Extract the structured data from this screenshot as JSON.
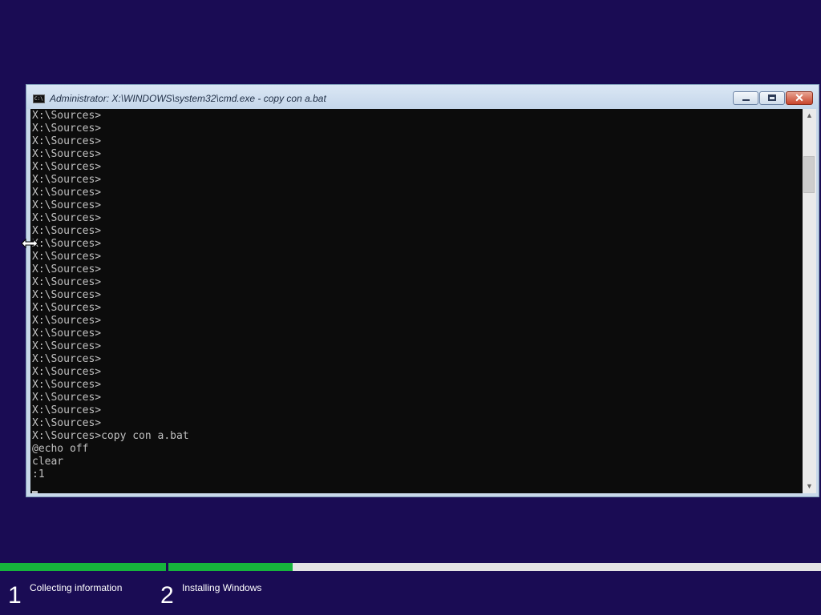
{
  "window": {
    "title": "Administrator: X:\\WINDOWS\\system32\\cmd.exe - copy  con a.bat",
    "icon": "console-icon",
    "icon_label": "C:\\",
    "buttons": {
      "close_glyph": "✕"
    }
  },
  "console": {
    "lines": [
      "X:\\Sources>",
      "X:\\Sources>",
      "X:\\Sources>",
      "X:\\Sources>",
      "X:\\Sources>",
      "X:\\Sources>",
      "X:\\Sources>",
      "X:\\Sources>",
      "X:\\Sources>",
      "X:\\Sources>",
      "X:\\Sources>",
      "X:\\Sources>",
      "X:\\Sources>",
      "X:\\Sources>",
      "X:\\Sources>",
      "X:\\Sources>",
      "X:\\Sources>",
      "X:\\Sources>",
      "X:\\Sources>",
      "X:\\Sources>",
      "X:\\Sources>",
      "X:\\Sources>",
      "X:\\Sources>",
      "X:\\Sources>",
      "X:\\Sources>",
      "X:\\Sources>copy con a.bat",
      "@echo off",
      "clear",
      ":1"
    ],
    "background": "#0c0c0c",
    "foreground": "#c0c0c0"
  },
  "scrollbar": {
    "up_glyph": "▲",
    "down_glyph": "▼"
  },
  "setup": {
    "background": "#1a0c54",
    "progress_color": "#16b43c",
    "steps": [
      {
        "number": "1",
        "label": "Collecting information",
        "progress": 1.0
      },
      {
        "number": "2",
        "label": "Installing Windows",
        "progress": 0.19
      }
    ]
  }
}
